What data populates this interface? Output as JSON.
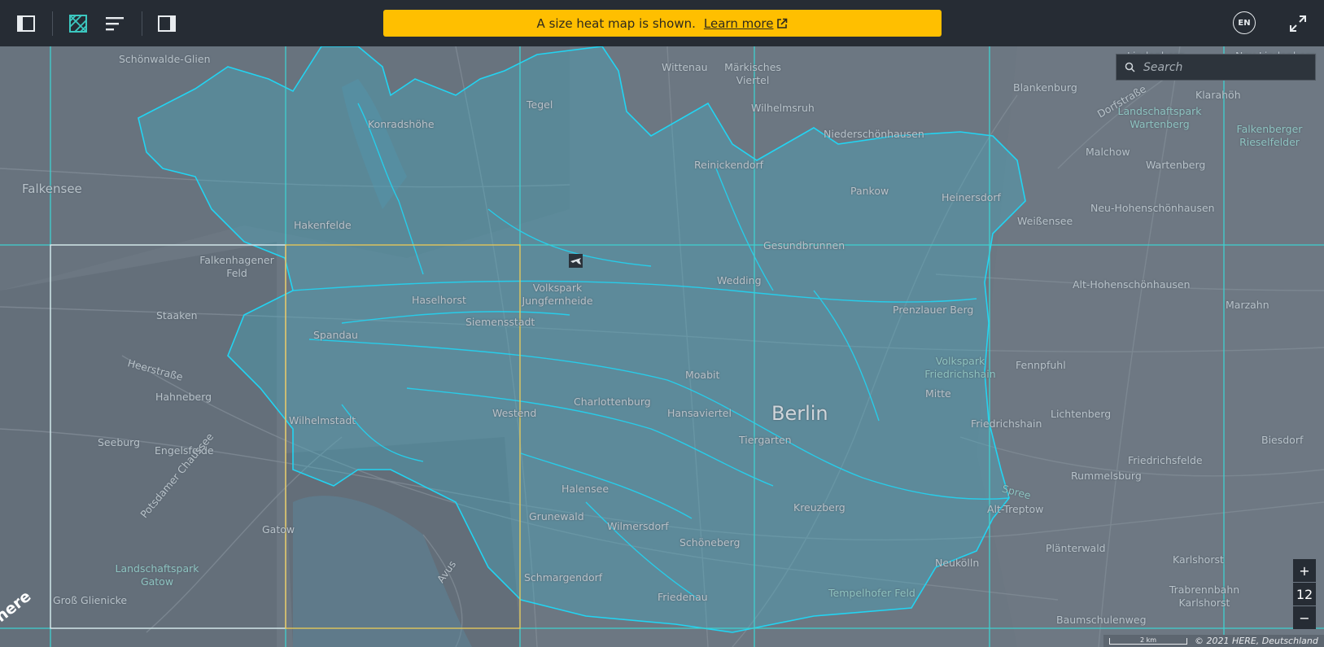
{
  "toolbar": {
    "icons": [
      "sidebar-left-icon",
      "heatmap-icon",
      "list-icon",
      "sidebar-right-icon",
      "expand-icon"
    ],
    "accent_color": "#3cc8c0"
  },
  "banner": {
    "text": "A size heat map is shown.",
    "link_label": "Learn more",
    "color": "#ffbf00"
  },
  "language": {
    "code": "EN"
  },
  "search": {
    "placeholder": "Search"
  },
  "zoom": {
    "level": "12",
    "plus": "+",
    "minus": "−"
  },
  "attribution": {
    "text": "© 2021 HERE, Deutschland",
    "scale_label": "2 km"
  },
  "logo": {
    "text": "here"
  },
  "map": {
    "city_label": "Berlin",
    "places": [
      "Schönwalde-Glien",
      "Wittenau",
      "Märkisches Viertel",
      "Lindenberg",
      "Neu Lindenberg",
      "Blankenburg",
      "Klarahöh",
      "Tegel",
      "Wilhelmsruh",
      "Konradshöhe",
      "Niederschönhausen",
      "Landschaftspark Wartenberg",
      "Falkenberger Rieselfelder",
      "Malchow",
      "Wartenberg",
      "Reinickendorf",
      "Falkensee",
      "Pankow",
      "Heinersdorf",
      "Weißensee",
      "Neu-Hohenschönhausen",
      "Hakenfelde",
      "Falkenhagener Feld",
      "Gesundbrunnen",
      "Alt-Hohenschönhausen",
      "Staaken",
      "Haselhorst",
      "Volkspark Jungfernheide",
      "Siemensstadt",
      "Wedding",
      "Prenzlauer Berg",
      "Marzahn",
      "Spandau",
      "Moabit",
      "Volkspark Friedrichshain",
      "Fennpfuhl",
      "Heerstraße",
      "Hahneberg",
      "Charlottenburg",
      "Westend",
      "Mitte",
      "Lichtenberg",
      "Wilhelmstadt",
      "Hansaviertel",
      "Tiergarten",
      "Friedrichshain",
      "Biesdorf",
      "Seeburg",
      "Engelsfelde",
      "Friedrichsfelde",
      "Rummelsburg",
      "Halensee",
      "Kreuzberg",
      "Alt-Treptow",
      "Potsdamer Chaussee",
      "Gatow",
      "Grunewald",
      "Wilmersdorf",
      "Schöneberg",
      "Plänterwald",
      "Karlshorst",
      "Landschaftspark Gatow",
      "Neukölln",
      "Trabrennbahn Karlshorst",
      "Schmargendorf",
      "Tempelhofer Feld",
      "Friedenau",
      "Groß Glienicke",
      "Avus",
      "Spree",
      "Dorfstraße",
      "Baumschulenweg"
    ]
  }
}
